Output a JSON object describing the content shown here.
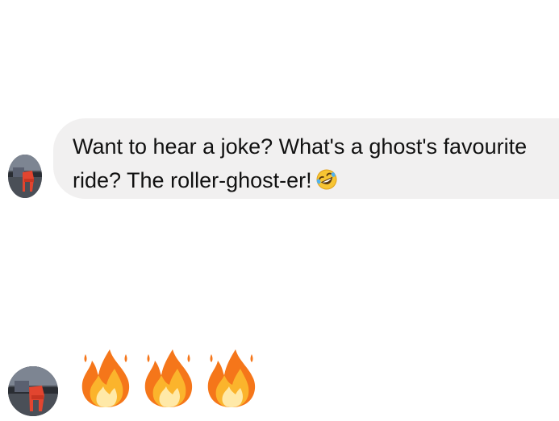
{
  "messages": [
    {
      "type": "text",
      "lines": [
        "Want to hear a joke? What's a ghost's favourite",
        "ride? The roller-ghost-er!"
      ],
      "emoji": "rolling-on-floor-laughing"
    },
    {
      "type": "emoji",
      "emojis": [
        "fire",
        "fire",
        "fire"
      ]
    }
  ],
  "colors": {
    "bubble_bg": "#f1f0f0",
    "text": "#111111",
    "background": "#ffffff"
  }
}
